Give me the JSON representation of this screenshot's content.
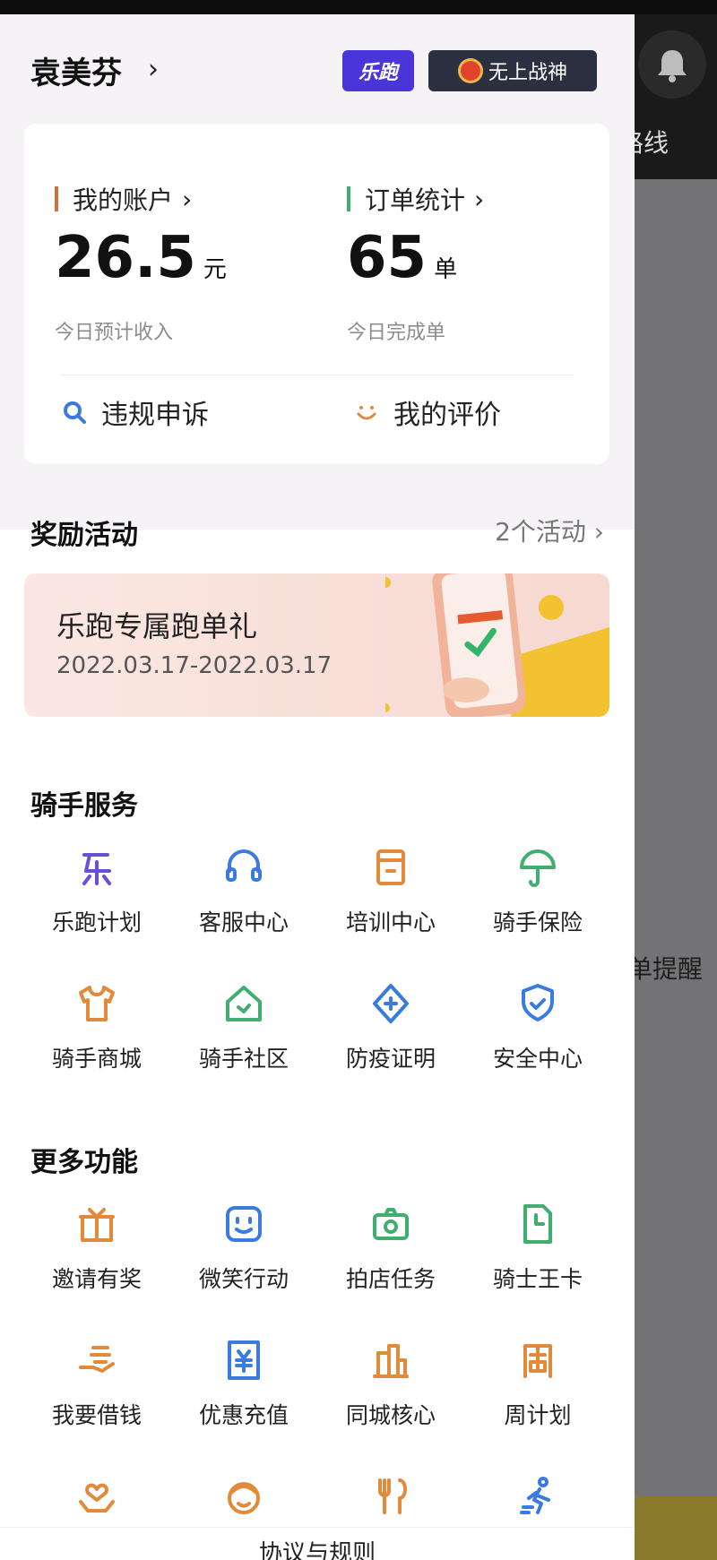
{
  "background_app": {
    "route_label": "路线",
    "reminder_label": "单提醒"
  },
  "drawer": {
    "user": {
      "name": "袁美芬",
      "badge_lepao": "乐跑",
      "badge_rank": "无上战神"
    },
    "account": {
      "title": "我的账户",
      "amount": "26.5",
      "unit": "元",
      "caption": "今日预计收入"
    },
    "orders": {
      "title": "订单统计",
      "count": "65",
      "unit": "单",
      "caption": "今日完成单"
    },
    "actions": {
      "appeal": "违规申诉",
      "reviews": "我的评价"
    },
    "rewards": {
      "title": "奖励活动",
      "count_link": "2个活动",
      "banner": {
        "title": "乐跑专属跑单礼",
        "date": "2022.03.17-2022.03.17"
      }
    },
    "rider_services": {
      "title": "骑手服务",
      "items": [
        {
          "label": "乐跑计划",
          "icon": "le-icon",
          "color": "#6a4fd8"
        },
        {
          "label": "客服中心",
          "icon": "headset-icon",
          "color": "#3a7be0"
        },
        {
          "label": "培训中心",
          "icon": "book-icon",
          "color": "#e08a3a"
        },
        {
          "label": "骑手保险",
          "icon": "umbrella-icon",
          "color": "#3fae6e"
        },
        {
          "label": "骑手商城",
          "icon": "tshirt-icon",
          "color": "#e08a3a"
        },
        {
          "label": "骑手社区",
          "icon": "home-heart-icon",
          "color": "#3fae6e"
        },
        {
          "label": "防疫证明",
          "icon": "medical-icon",
          "color": "#3a7be0"
        },
        {
          "label": "安全中心",
          "icon": "shield-icon",
          "color": "#3a7be0"
        }
      ]
    },
    "more_features": {
      "title": "更多功能",
      "items": [
        {
          "label": "邀请有奖",
          "icon": "gift-icon",
          "color": "#e08a3a"
        },
        {
          "label": "微笑行动",
          "icon": "smile-icon",
          "color": "#3a7be0"
        },
        {
          "label": "拍店任务",
          "icon": "camera-icon",
          "color": "#3fae6e"
        },
        {
          "label": "骑士王卡",
          "icon": "sim-card-icon",
          "color": "#3fae6e"
        },
        {
          "label": "我要借钱",
          "icon": "hand-money-icon",
          "color": "#e08a3a"
        },
        {
          "label": "优惠充值",
          "icon": "recharge-icon",
          "color": "#3a7be0"
        },
        {
          "label": "同城核心",
          "icon": "city-icon",
          "color": "#e08a3a"
        },
        {
          "label": "周计划",
          "icon": "week-plan-icon",
          "color": "#e08a3a"
        },
        {
          "label": "",
          "icon": "heart-hand-icon",
          "color": "#e08a3a"
        },
        {
          "label": "",
          "icon": "face-icon",
          "color": "#e08a3a"
        },
        {
          "label": "",
          "icon": "fork-spoon-icon",
          "color": "#e08a3a"
        },
        {
          "label": "",
          "icon": "runner-icon",
          "color": "#3a7be0"
        }
      ]
    },
    "footer": {
      "label": "协议与规则"
    }
  }
}
